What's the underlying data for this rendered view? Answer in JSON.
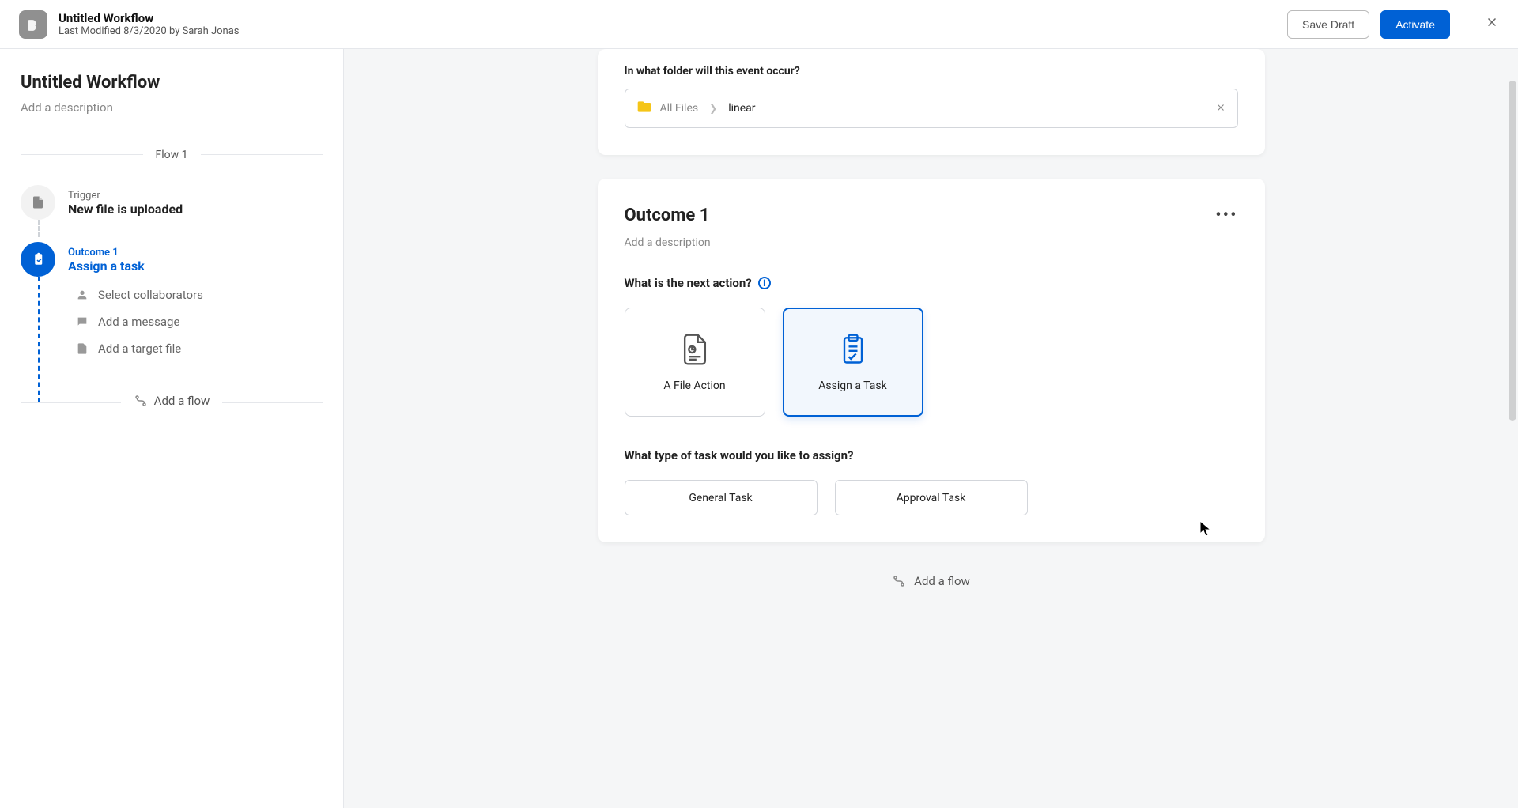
{
  "header": {
    "title": "Untitled Workflow",
    "subtitle": "Last Modified 8/3/2020 by Sarah Jonas",
    "save_label": "Save Draft",
    "activate_label": "Activate"
  },
  "sidebar": {
    "title": "Untitled Workflow",
    "desc_placeholder": "Add a description",
    "flow_label": "Flow 1",
    "trigger": {
      "eyebrow": "Trigger",
      "title": "New file is uploaded"
    },
    "outcome": {
      "eyebrow": "Outcome 1",
      "title": "Assign a task"
    },
    "sub_items": [
      "Select collaborators",
      "Add a message",
      "Add a target file"
    ],
    "add_flow_label": "Add a flow"
  },
  "folder_card": {
    "question": "In what folder will this event occur?",
    "root": "All Files",
    "leaf": "linear"
  },
  "outcome_card": {
    "title": "Outcome 1",
    "desc_placeholder": "Add a description",
    "next_action_question": "What is the next action?",
    "options": {
      "file_action": "A File Action",
      "assign_task": "Assign a Task"
    },
    "task_type_question": "What type of task would you like to assign?",
    "task_types": {
      "general": "General Task",
      "approval": "Approval Task"
    }
  },
  "bottom": {
    "add_flow_label": "Add a flow"
  },
  "colors": {
    "primary": "#0061d5"
  }
}
